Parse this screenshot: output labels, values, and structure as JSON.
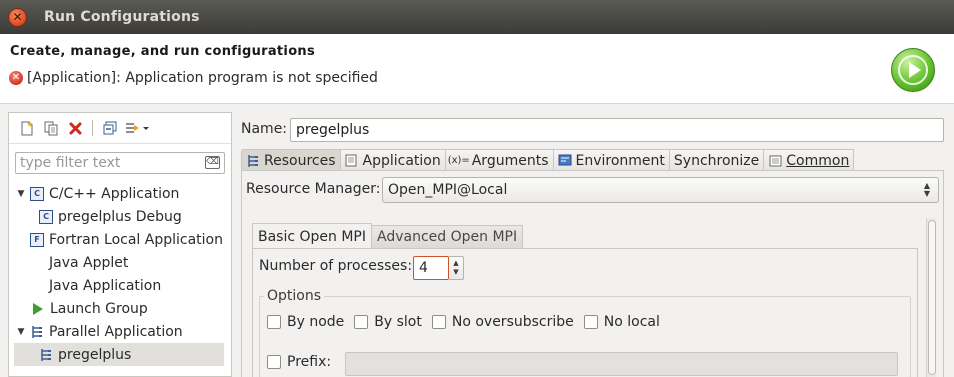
{
  "window": {
    "title": "Run Configurations",
    "close_glyph": "✕"
  },
  "header": {
    "title": "Create, manage, and run configurations",
    "error_message": "[Application]: Application program is not specified",
    "run_icon": "run-launch-icon"
  },
  "sidebar": {
    "toolbar_icons": [
      "new-config-icon",
      "duplicate-icon",
      "delete-icon",
      "collapse-all-icon",
      "filter-icon"
    ],
    "filter_placeholder": "type filter text",
    "tree": [
      {
        "label": "C/C++ Application",
        "level": 0,
        "expanded": true,
        "icon": "c-app-icon"
      },
      {
        "label": "pregelplus Debug",
        "level": 1,
        "icon": "c-app-icon"
      },
      {
        "label": "Fortran Local Application",
        "level": 0,
        "icon": "fortran-app-icon"
      },
      {
        "label": "Java Applet",
        "level": 0,
        "icon": "none"
      },
      {
        "label": "Java Application",
        "level": 0,
        "icon": "none"
      },
      {
        "label": "Launch Group",
        "level": 0,
        "icon": "launch-group-icon"
      },
      {
        "label": "Parallel Application",
        "level": 0,
        "expanded": true,
        "icon": "parallel-app-icon"
      },
      {
        "label": "pregelplus",
        "level": 1,
        "selected": true,
        "icon": "parallel-app-icon"
      }
    ]
  },
  "main": {
    "name_label": "Name:",
    "name_value": "pregelplus",
    "tabs": [
      {
        "label": "Resources",
        "icon": "resources-icon",
        "active": true
      },
      {
        "label": "Application",
        "icon": "application-icon"
      },
      {
        "label": "Arguments",
        "icon": "arguments-icon"
      },
      {
        "label": "Environment",
        "icon": "environment-icon"
      },
      {
        "label": "Synchronize",
        "icon": "none"
      },
      {
        "label": "Common",
        "icon": "common-icon"
      }
    ],
    "resource_manager_label": "Resource Manager:",
    "resource_manager_value": "Open_MPI@Local",
    "subtabs": [
      {
        "label": "Basic Open MPI",
        "active": true
      },
      {
        "label": "Advanced Open MPI"
      }
    ],
    "num_processes_label": "Number of processes:",
    "num_processes_value": "4",
    "options_label": "Options",
    "options": [
      "By node",
      "By slot",
      "No oversubscribe",
      "No local"
    ],
    "prefix_label": "Prefix:",
    "prefix_value": ""
  }
}
